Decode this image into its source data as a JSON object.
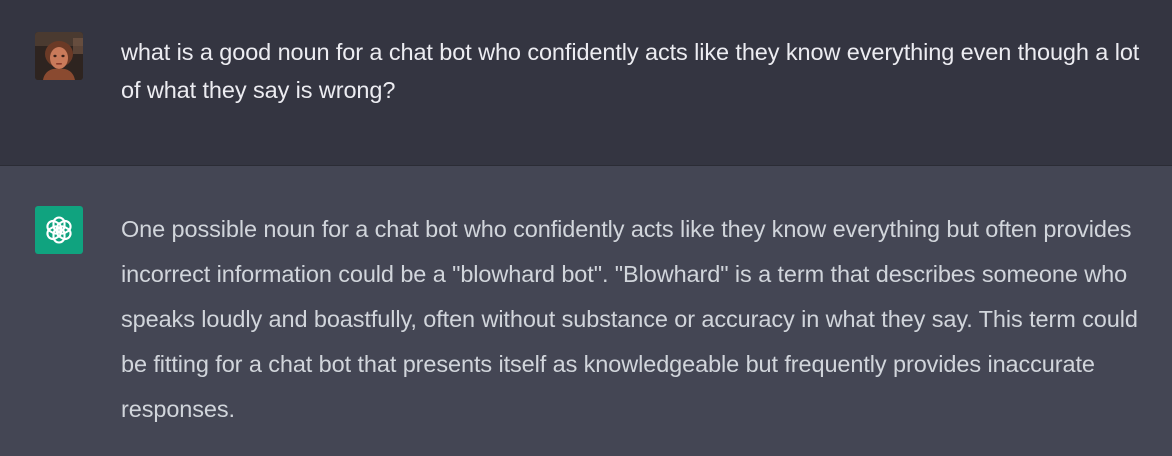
{
  "conversation": {
    "user_message": {
      "avatar_icon": "user-photo-avatar",
      "text": "what is a good noun for a chat bot who confidently acts like they know everything even though a lot of what they say is wrong?"
    },
    "assistant_message": {
      "avatar_icon": "openai-logo-icon",
      "avatar_color": "#10a37f",
      "text": "One possible noun for a chat bot who confidently acts like they know everything but often provides incorrect information could be a \"blowhard bot\". \"Blowhard\" is a term that describes someone who speaks loudly and boastfully, often without substance or accuracy in what they say. This term could be fitting for a chat bot that presents itself as knowledgeable but frequently provides inaccurate responses."
    }
  },
  "colors": {
    "user_row_bg": "#343541",
    "assistant_row_bg": "#444654",
    "user_text": "#ececf1",
    "assistant_text": "#d1d5db"
  }
}
